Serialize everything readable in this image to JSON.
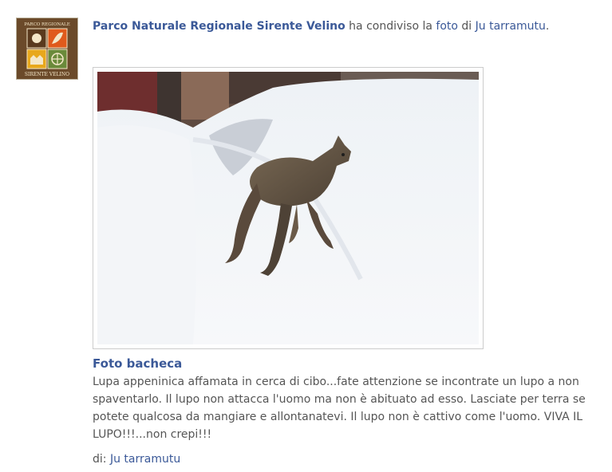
{
  "post": {
    "page_name": "Parco Naturale Regionale Sirente Velino",
    "action_text": " ha condiviso la ",
    "object_link": "foto",
    "of_text": " di ",
    "owner_name": "Ju tarramutu",
    "period": ".",
    "avatar": {
      "icon": "park-logo-icon",
      "line1": "PARCO REGIONALE",
      "line2": "SIRENTE VELINO"
    },
    "photo_icon": "wolf-in-snow-photo",
    "album_title": "Foto bacheca",
    "caption": "Lupa appeninica affamata in cerca di cibo...fate attenzione se incontrate un lupo a non spaventarlo. Il lupo non attacca l'uomo ma non è abituato ad esso. Lasciate per terra se potete qualcosa da mangiare e allontanatevi. Il lupo non è cattivo come l'uomo. VIVA IL LUPO!!!...non crepi!!!",
    "byline_prefix": "di: ",
    "byline_name": "Ju tarramutu"
  }
}
